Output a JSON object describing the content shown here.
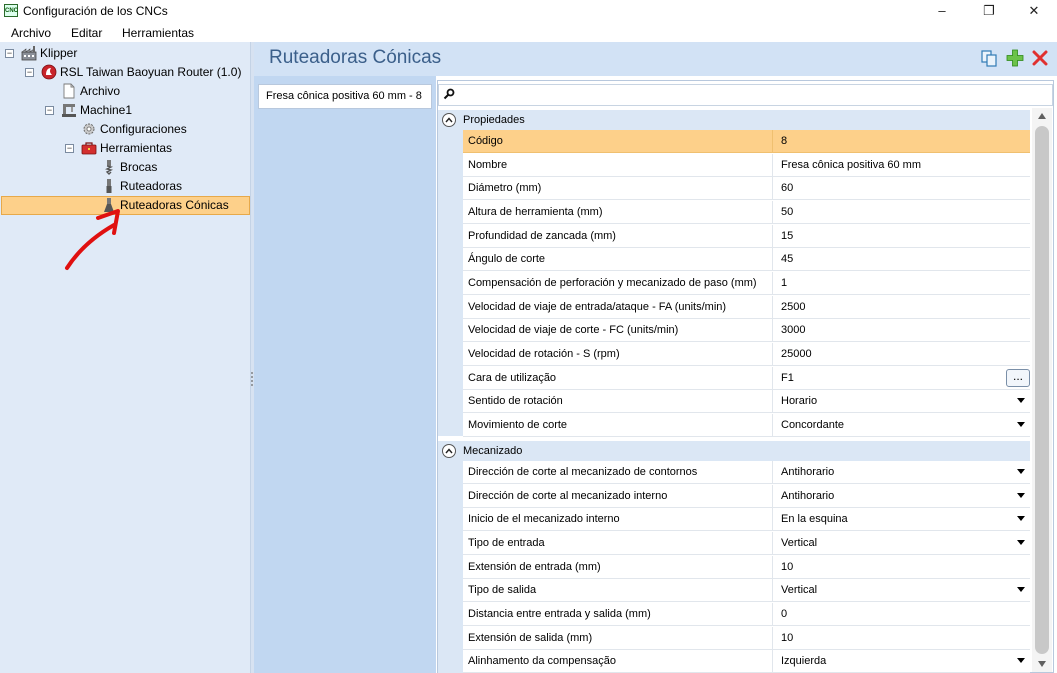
{
  "window": {
    "title": "Configuración de los CNCs",
    "app_icon_text": "CNC",
    "controls": {
      "minimize": "–",
      "maximize": "❐",
      "close": "✕"
    }
  },
  "menu": [
    "Archivo",
    "Editar",
    "Herramientas"
  ],
  "tree": {
    "root": "Klipper",
    "router": "RSL Taiwan Baoyuan Router (1.0)",
    "archivo": "Archivo",
    "machine": "Machine1",
    "configuraciones": "Configuraciones",
    "herramientas": "Herramientas",
    "brocas": "Brocas",
    "ruteadoras": "Ruteadoras",
    "ruteadoras_conicas": "Ruteadoras Cónicas",
    "expander_symbol": "−"
  },
  "header": {
    "title": "Ruteadoras Cónicas",
    "actions": [
      "copy-icon",
      "add-icon",
      "delete-icon"
    ]
  },
  "list": {
    "items": [
      "Fresa cônica positiva 60 mm - 8"
    ]
  },
  "properties": {
    "search_placeholder": "",
    "categories": [
      {
        "label": "Propiedades",
        "rows": [
          {
            "name": "Código",
            "value": "8",
            "selected": true
          },
          {
            "name": "Nombre",
            "value": "Fresa cônica positiva 60 mm"
          },
          {
            "name": "Diámetro (mm)",
            "value": "60"
          },
          {
            "name": "Altura de herramienta (mm)",
            "value": "50"
          },
          {
            "name": "Profundidad de zancada (mm)",
            "value": "15"
          },
          {
            "name": "Ángulo de corte",
            "value": "45"
          },
          {
            "name": "Compensación de perforación y mecanizado de paso (mm)",
            "value": "1"
          },
          {
            "name": "Velocidad de viaje de entrada/ataque - FA (units/min)",
            "value": "2500"
          },
          {
            "name": "Velocidad de viaje de corte - FC (units/min)",
            "value": "3000"
          },
          {
            "name": "Velocidad de rotación - S (rpm)",
            "value": "25000"
          },
          {
            "name": "Cara de utilização",
            "value": "F1",
            "editor": "ellipsis",
            "button_label": "..."
          },
          {
            "name": "Sentido de rotación",
            "value": "Horario",
            "editor": "dropdown"
          },
          {
            "name": "Movimiento de corte",
            "value": "Concordante",
            "editor": "dropdown"
          }
        ]
      },
      {
        "label": "Mecanizado",
        "rows": [
          {
            "name": "Dirección de corte al mecanizado de contornos",
            "value": "Antihorario",
            "editor": "dropdown"
          },
          {
            "name": "Dirección de corte al mecanizado interno",
            "value": "Antihorario",
            "editor": "dropdown"
          },
          {
            "name": "Inicio de el mecanizado interno",
            "value": "En la esquina",
            "editor": "dropdown"
          },
          {
            "name": "Tipo de entrada",
            "value": "Vertical",
            "editor": "dropdown"
          },
          {
            "name": "Extensión de entrada (mm)",
            "value": "10"
          },
          {
            "name": "Tipo de salida",
            "value": "Vertical",
            "editor": "dropdown"
          },
          {
            "name": "Distancia entre entrada y salida (mm)",
            "value": "0"
          },
          {
            "name": "Extensión de salida (mm)",
            "value": "10"
          },
          {
            "name": "Alinhamento da compensação",
            "value": "Izquierda",
            "editor": "dropdown"
          }
        ]
      }
    ]
  },
  "colors": {
    "selection": "#fdd08a",
    "header_bg": "#d2e2f5",
    "tree_bg": "#e0eaf7",
    "title_text": "#3b5f8a",
    "annotation_arrow": "#e01010"
  }
}
